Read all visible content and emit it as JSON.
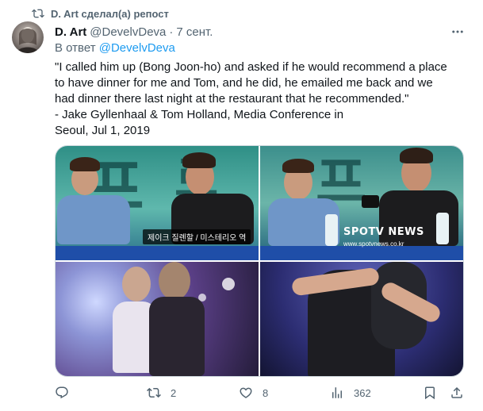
{
  "repost": {
    "text": "D. Art сделал(а) репост",
    "icon": "repost-icon"
  },
  "tweet": {
    "author_name": "D. Art",
    "author_handle": "@DevelvDeva",
    "separator": "·",
    "time": "7 сент.",
    "reply_prefix": "В ответ",
    "reply_handle": "@DevelvDeva",
    "text": "\"I called him up (Bong Joon-ho) and asked if he would recommend a place\nto have dinner for me and Tom, and he did, he emailed me back and we\nhad dinner there last night at the restaurant that he recommended.\"\n- Jake Gyllenhaal & Tom Holland, Media Conference in\nSeoul, Jul 1, 2019"
  },
  "media": {
    "photos": [
      {
        "name": "press-conference-photo",
        "caption": "제이크 질렌할 / 미스테리오 역"
      },
      {
        "name": "selfie-photo",
        "watermark": "SPOTV NEWS",
        "watermark_sub": "www.spotvnews.co.kr"
      },
      {
        "name": "stage-photo"
      },
      {
        "name": "hug-photo"
      }
    ]
  },
  "actions": {
    "reply_icon": "reply-icon",
    "reply_count": "",
    "repost_icon": "repost-icon",
    "repost_count": "2",
    "like_icon": "heart-icon",
    "like_count": "8",
    "views_icon": "views-icon",
    "views_count": "362",
    "bookmark_icon": "bookmark-icon",
    "share_icon": "share-icon"
  },
  "colors": {
    "accent": "#1d9bf0",
    "muted": "#536471",
    "text": "#0f1419",
    "border": "#cfd9de"
  }
}
